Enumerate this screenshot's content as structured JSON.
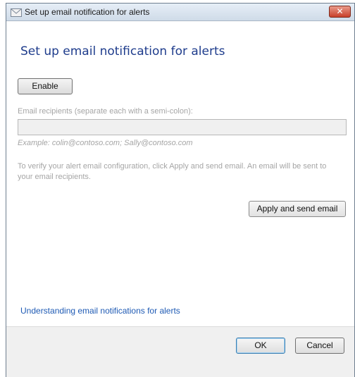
{
  "window": {
    "title": "Set up email notification for alerts",
    "close_label": "✕",
    "icon": "mail-icon"
  },
  "main": {
    "heading": "Set up email notification for alerts",
    "enable_button": "Enable",
    "recipients_label": "Email recipients (separate each with a semi-colon):",
    "recipients_value": "",
    "example": "Example: colin@contoso.com; Sally@contoso.com",
    "verify_text": "To verify your alert email configuration, click Apply and send email. An email will be sent to your email recipients.",
    "apply_button": "Apply and send email",
    "help_link": "Understanding email notifications for alerts"
  },
  "footer": {
    "ok_button": "OK",
    "cancel_button": "Cancel"
  }
}
